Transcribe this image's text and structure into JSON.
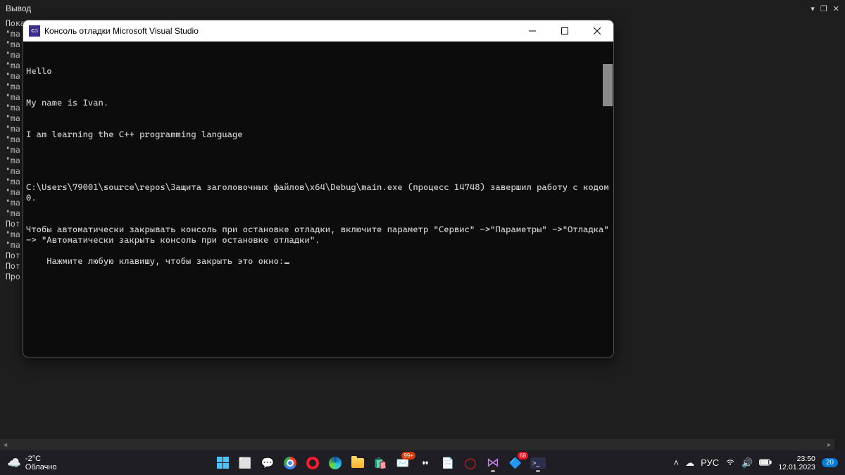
{
  "vs": {
    "panel_title": "Вывод",
    "chevron": "▾",
    "window_icon": "❐",
    "close": "✕",
    "output_lines": [
      "Пока",
      "\"ma",
      "\"ma",
      "\"ma",
      "\"ma",
      "\"ma",
      "\"ma",
      "\"ma",
      "\"ma",
      "\"ma",
      "\"ma",
      "\"ma",
      "\"ma",
      "\"ma",
      "\"ma",
      "\"ma",
      "\"ma",
      "\"ma",
      "\"ma",
      "Пот",
      "\"ma",
      "\"ma",
      "Пот",
      "Пот",
      "Про"
    ],
    "scroll_left": "◄",
    "scroll_right": "►"
  },
  "console": {
    "icon_text": "C:\\",
    "title": "Консоль отладки Microsoft Visual Studio",
    "lines": [
      "Hello",
      "My name is Ivan.",
      "I am learning the C++ programming language",
      "",
      "C:\\Users\\79001\\source\\repos\\Защита заголовочных файлов\\x64\\Debug\\main.exe (процесс 14748) завершил работу с кодом 0.",
      "Чтобы автоматически закрывать консоль при остановке отладки, включите параметр \"Сервис\" ->\"Параметры\" ->\"Отладка\" -> \"Автоматически закрыть консоль при остановке отладки\".",
      "Нажмите любую клавишу, чтобы закрыть это окно:"
    ]
  },
  "taskbar": {
    "weather_temp": "-2°C",
    "weather_desc": "Облачно",
    "mail_badge": "99+",
    "badge68": "68",
    "tray": {
      "chevron": "˄",
      "lang": "РУС"
    },
    "time": "23:50",
    "date": "12.01.2023",
    "notif_count": "20"
  }
}
